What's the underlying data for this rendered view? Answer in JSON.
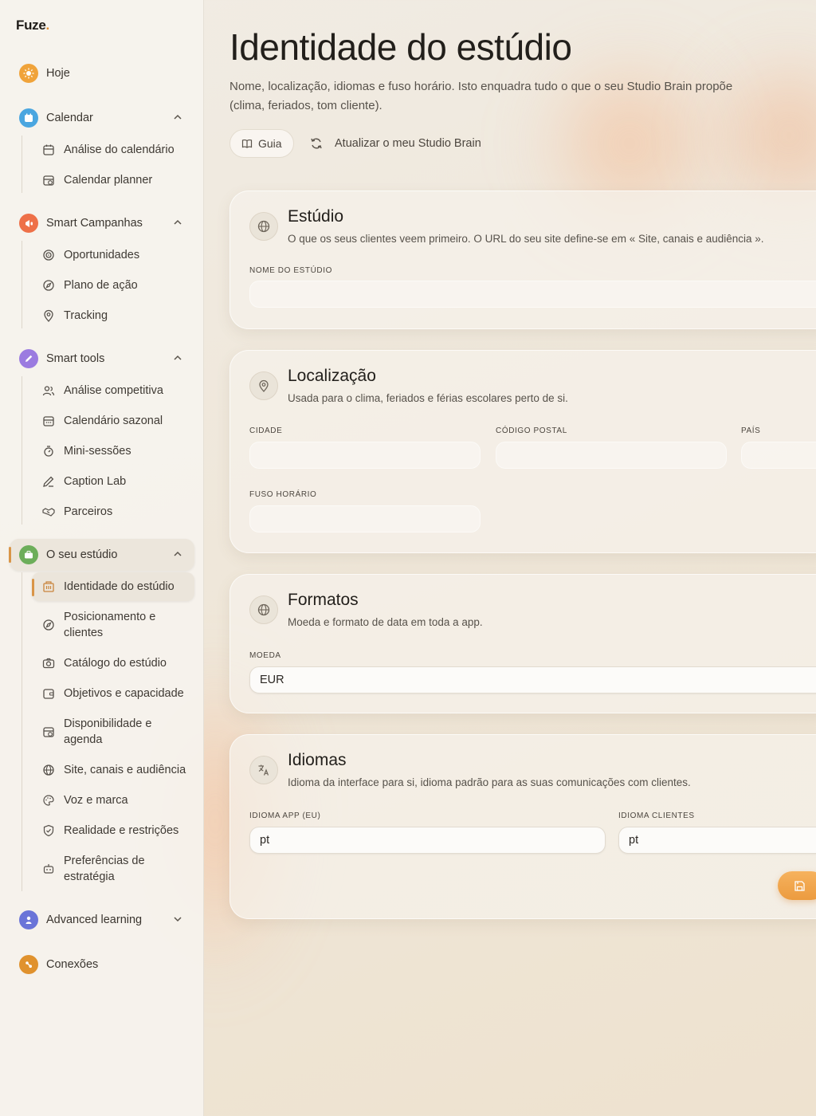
{
  "brand": {
    "name": "Fuze",
    "dot": "."
  },
  "sidebar": {
    "items": [
      {
        "label": "Hoje",
        "icon": "sun-icon",
        "color": "#f0a33a"
      },
      {
        "label": "Calendar",
        "icon": "calendar-icon",
        "color": "#4aa6e0"
      },
      {
        "label": "Smart Campanhas",
        "icon": "megaphone-icon",
        "color": "#ee7048"
      },
      {
        "label": "Smart tools",
        "icon": "pencil-icon",
        "color": "#9b7be0"
      },
      {
        "label": "O seu estúdio",
        "icon": "briefcase-icon",
        "color": "#6dae5a"
      },
      {
        "label": "Advanced learning",
        "icon": "graduation-icon",
        "color": "#6a74d8"
      },
      {
        "label": "Conexões",
        "icon": "plug-icon",
        "color": "#e0922e"
      }
    ],
    "calendar_sub": [
      "Análise do calendário",
      "Calendar planner"
    ],
    "campanhas_sub": [
      "Oportunidades",
      "Plano de ação",
      "Tracking"
    ],
    "tools_sub": [
      "Análise competitiva",
      "Calendário sazonal",
      "Mini-sessões",
      "Caption Lab",
      "Parceiros"
    ],
    "estudio_sub": [
      "Identidade do estúdio",
      "Posicionamento e clientes",
      "Catálogo do estúdio",
      "Objetivos e capacidade",
      "Disponibilidade e agenda",
      "Site, canais e audiência",
      "Voz e marca",
      "Realidade e restrições",
      "Preferências de estratégia"
    ]
  },
  "header": {
    "title": "Identidade do estúdio",
    "subtitle": "Nome, localização, idiomas e fuso horário. Isto enquadra tudo o que o seu Studio Brain propõe (clima, feriados, tom cliente).",
    "guide_label": "Guia",
    "refresh_label": "Atualizar o meu Studio Brain"
  },
  "cards": {
    "estudio": {
      "title": "Estúdio",
      "desc": "O que os seus clientes veem primeiro. O URL do seu site define-se em « Site, canais e audiência ».",
      "name_label": "Nome do estúdio",
      "name_value": ""
    },
    "localizacao": {
      "title": "Localização",
      "desc": "Usada para o clima, feriados e férias escolares perto de si.",
      "city_label": "Cidade",
      "postal_label": "Código postal",
      "country_label": "País",
      "tz_label": "Fuso horário",
      "city_value": "",
      "postal_value": "",
      "country_value": "",
      "tz_value": ""
    },
    "formatos": {
      "title": "Formatos",
      "desc": "Moeda e formato de data em toda a app.",
      "currency_label": "Moeda",
      "currency_value": "EUR"
    },
    "idiomas": {
      "title": "Idiomas",
      "desc": "Idioma da interface para si, idioma padrão para as suas comunicações com clientes.",
      "app_label": "Idioma app (EU)",
      "app_value": "pt",
      "clients_label": "Idioma clientes",
      "clients_value": "pt"
    }
  }
}
